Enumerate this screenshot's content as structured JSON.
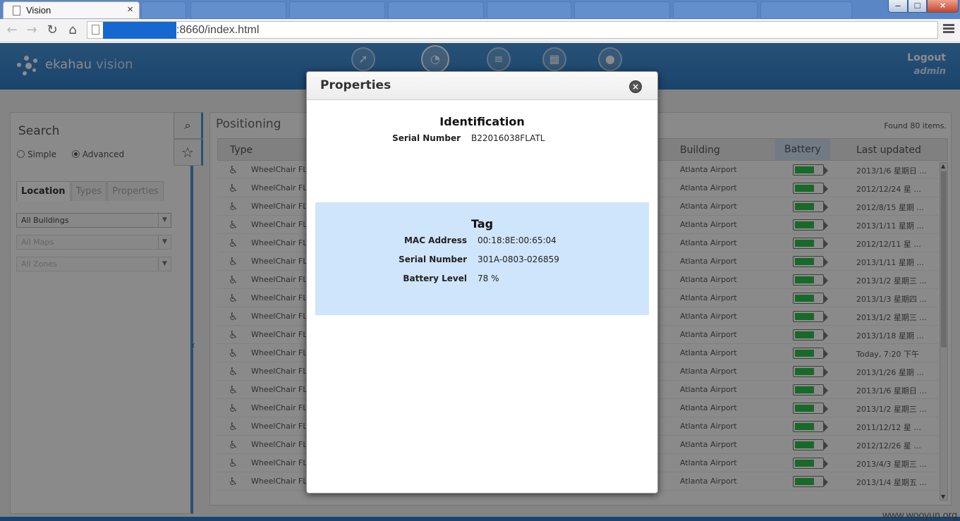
{
  "browser": {
    "tab_title": "Vision",
    "tab_close": "×",
    "url_suffix": ":8660/index.html",
    "window_buttons": [
      "–",
      "□",
      "×"
    ]
  },
  "app": {
    "logo_name": "ekahau",
    "logo_product": "vision",
    "logout_label": "Logout",
    "user_name": "admin",
    "nav_icons": [
      "positioning-icon",
      "dashboard-icon",
      "list-icon",
      "reports-icon",
      "user-icon"
    ]
  },
  "left": {
    "search_title": "Search",
    "radio_simple": "Simple",
    "radio_advanced": "Advanced",
    "tabs": [
      "Location",
      "Types",
      "Properties"
    ],
    "buildings": "All Buildings",
    "maps": "All Maps",
    "zones": "All Zones"
  },
  "main": {
    "title": "Positioning",
    "found": "Found 80 items.",
    "columns": {
      "type": "Type",
      "building": "Building",
      "battery": "Battery",
      "updated": "Last updated"
    },
    "rows": [
      {
        "type": "WheelChair FL",
        "building": "Atlanta Airport",
        "battery_level": 0.78,
        "updated": "2013/1/6 星期日 ..."
      },
      {
        "type": "WheelChair FL",
        "building": "Atlanta Airport",
        "battery_level": 0.78,
        "updated": "2012/12/24 星 ..."
      },
      {
        "type": "WheelChair FL",
        "building": "Atlanta Airport",
        "battery_level": 0.78,
        "updated": "2012/8/15 星期 ..."
      },
      {
        "type": "WheelChair FL",
        "building": "Atlanta Airport",
        "battery_level": 0.78,
        "updated": "2013/1/11 星期 ..."
      },
      {
        "type": "WheelChair FL",
        "building": "Atlanta Airport",
        "battery_level": 0.78,
        "updated": "2012/12/11 星 ..."
      },
      {
        "type": "WheelChair FL",
        "building": "Atlanta Airport",
        "battery_level": 0.78,
        "updated": "2013/1/11 星期 ..."
      },
      {
        "type": "WheelChair FL",
        "building": "Atlanta Airport",
        "battery_level": 0.78,
        "updated": "2013/1/2 星期三 ..."
      },
      {
        "type": "WheelChair FL",
        "building": "Atlanta Airport",
        "battery_level": 0.78,
        "updated": "2013/1/3 星期四 ..."
      },
      {
        "type": "WheelChair FL",
        "building": "Atlanta Airport",
        "battery_level": 0.78,
        "updated": "2013/1/2 星期三 ..."
      },
      {
        "type": "WheelChair FL",
        "building": "Atlanta Airport",
        "battery_level": 0.78,
        "updated": "2013/1/18 星期 ..."
      },
      {
        "type": "WheelChair FL",
        "building": "Atlanta Airport",
        "battery_level": 0.78,
        "updated": "Today, 7:20 下午"
      },
      {
        "type": "WheelChair FL",
        "building": "Atlanta Airport",
        "battery_level": 0.78,
        "updated": "2013/1/26 星期 ..."
      },
      {
        "type": "WheelChair FL",
        "building": "Atlanta Airport",
        "battery_level": 0.78,
        "updated": "2013/1/6 星期日 ..."
      },
      {
        "type": "WheelChair FL",
        "building": "Atlanta Airport",
        "battery_level": 0.78,
        "updated": "2013/1/2 星期三 ..."
      },
      {
        "type": "WheelChair FL",
        "building": "Atlanta Airport",
        "battery_level": 0.78,
        "updated": "2011/12/12 星 ..."
      },
      {
        "type": "WheelChair FL",
        "building": "Atlanta Airport",
        "battery_level": 0.78,
        "updated": "2012/12/26 星 ..."
      },
      {
        "type": "WheelChair FL",
        "building": "Atlanta Airport",
        "battery_level": 0.78,
        "updated": "2013/4/3 星期三 ..."
      },
      {
        "type": "WheelChair FL",
        "building": "Atlanta Airport",
        "battery_level": 0.78,
        "updated": "2013/1/4 星期五 ..."
      }
    ]
  },
  "modal": {
    "title": "Properties",
    "close_icon": "close-icon",
    "identification": {
      "heading": "Identification",
      "serial_label": "Serial Number",
      "serial_value": "B22016038FLATL"
    },
    "tag": {
      "heading": "Tag",
      "mac_label": "MAC Address",
      "mac_value": "00:18:8E:00:65:04",
      "serial_label": "Serial Number",
      "serial_value": "301A-0803-026859",
      "battery_label": "Battery Level",
      "battery_value": "78 %"
    }
  },
  "watermark": "www.wooyun.org"
}
